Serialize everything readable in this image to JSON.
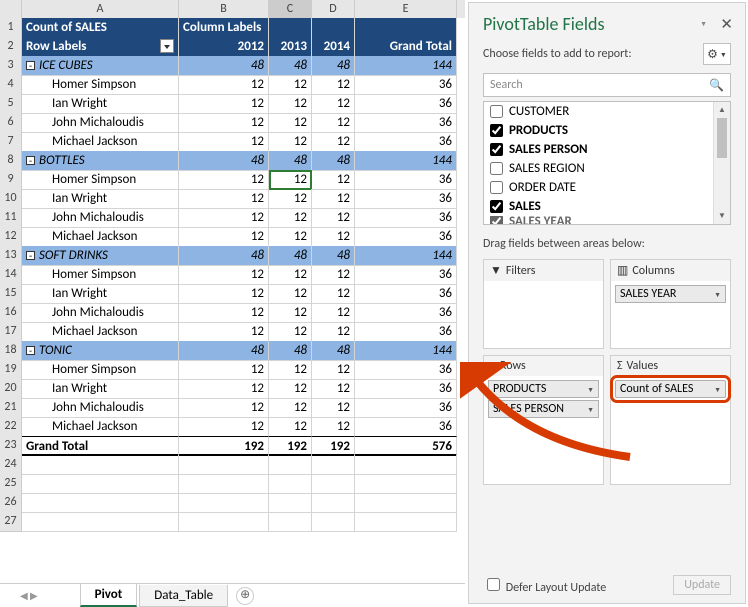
{
  "colHeaders": [
    "",
    "A",
    "B",
    "C",
    "D",
    "E"
  ],
  "hdr1": {
    "a": "Count of SALES",
    "b": "Column Labels"
  },
  "hdr2": {
    "a": "Row Labels",
    "b": "2012",
    "c": "2013",
    "d": "2014",
    "e": "Grand Total"
  },
  "groups": [
    {
      "name": "ICE CUBES",
      "c": "48",
      "d": "48",
      "e": "48",
      "t": "144",
      "rows": [
        {
          "a": "Homer Simpson",
          "c": "12",
          "d": "12",
          "e": "12",
          "t": "36"
        },
        {
          "a": "Ian Wright",
          "c": "12",
          "d": "12",
          "e": "12",
          "t": "36"
        },
        {
          "a": "John Michaloudis",
          "c": "12",
          "d": "12",
          "e": "12",
          "t": "36"
        },
        {
          "a": "Michael Jackson",
          "c": "12",
          "d": "12",
          "e": "12",
          "t": "36"
        }
      ]
    },
    {
      "name": "BOTTLES",
      "c": "48",
      "d": "48",
      "e": "48",
      "t": "144",
      "rows": [
        {
          "a": "Homer Simpson",
          "c": "12",
          "d": "12",
          "e": "12",
          "t": "36",
          "sel": true
        },
        {
          "a": "Ian Wright",
          "c": "12",
          "d": "12",
          "e": "12",
          "t": "36"
        },
        {
          "a": "John Michaloudis",
          "c": "12",
          "d": "12",
          "e": "12",
          "t": "36"
        },
        {
          "a": "Michael Jackson",
          "c": "12",
          "d": "12",
          "e": "12",
          "t": "36"
        }
      ]
    },
    {
      "name": "SOFT DRINKS",
      "c": "48",
      "d": "48",
      "e": "48",
      "t": "144",
      "rows": [
        {
          "a": "Homer Simpson",
          "c": "12",
          "d": "12",
          "e": "12",
          "t": "36"
        },
        {
          "a": "Ian Wright",
          "c": "12",
          "d": "12",
          "e": "12",
          "t": "36"
        },
        {
          "a": "John Michaloudis",
          "c": "12",
          "d": "12",
          "e": "12",
          "t": "36"
        },
        {
          "a": "Michael Jackson",
          "c": "12",
          "d": "12",
          "e": "12",
          "t": "36"
        }
      ]
    },
    {
      "name": "TONIC",
      "c": "48",
      "d": "48",
      "e": "48",
      "t": "144",
      "rows": [
        {
          "a": "Homer Simpson",
          "c": "12",
          "d": "12",
          "e": "12",
          "t": "36"
        },
        {
          "a": "Ian Wright",
          "c": "12",
          "d": "12",
          "e": "12",
          "t": "36"
        },
        {
          "a": "John Michaloudis",
          "c": "12",
          "d": "12",
          "e": "12",
          "t": "36"
        },
        {
          "a": "Michael Jackson",
          "c": "12",
          "d": "12",
          "e": "12",
          "t": "36"
        }
      ]
    }
  ],
  "grandTotal": {
    "a": "Grand Total",
    "c": "192",
    "d": "192",
    "e": "192",
    "t": "576"
  },
  "tabs": {
    "active": "Pivot",
    "other": "Data_Table"
  },
  "pane": {
    "title": "PivotTable Fields",
    "choose": "Choose fields to add to report:",
    "search": "Search",
    "fields": [
      {
        "label": "CUSTOMER",
        "checked": false,
        "bold": false
      },
      {
        "label": "PRODUCTS",
        "checked": true,
        "bold": true
      },
      {
        "label": "SALES PERSON",
        "checked": true,
        "bold": true
      },
      {
        "label": "SALES REGION",
        "checked": false,
        "bold": false
      },
      {
        "label": "ORDER DATE",
        "checked": false,
        "bold": false
      },
      {
        "label": "SALES",
        "checked": true,
        "bold": true
      },
      {
        "label": "SALES YEAR",
        "checked": true,
        "bold": true
      }
    ],
    "dragHint": "Drag fields between areas below:",
    "filters": "Filters",
    "columns": "Columns",
    "rows": "Rows",
    "values": "Values",
    "colPill": "SALES YEAR",
    "rowPill1": "PRODUCTS",
    "rowPill2": "SALES PERSON",
    "valPill": "Count of SALES",
    "defer": "Defer Layout Update",
    "update": "Update",
    "gear": "⚙"
  }
}
